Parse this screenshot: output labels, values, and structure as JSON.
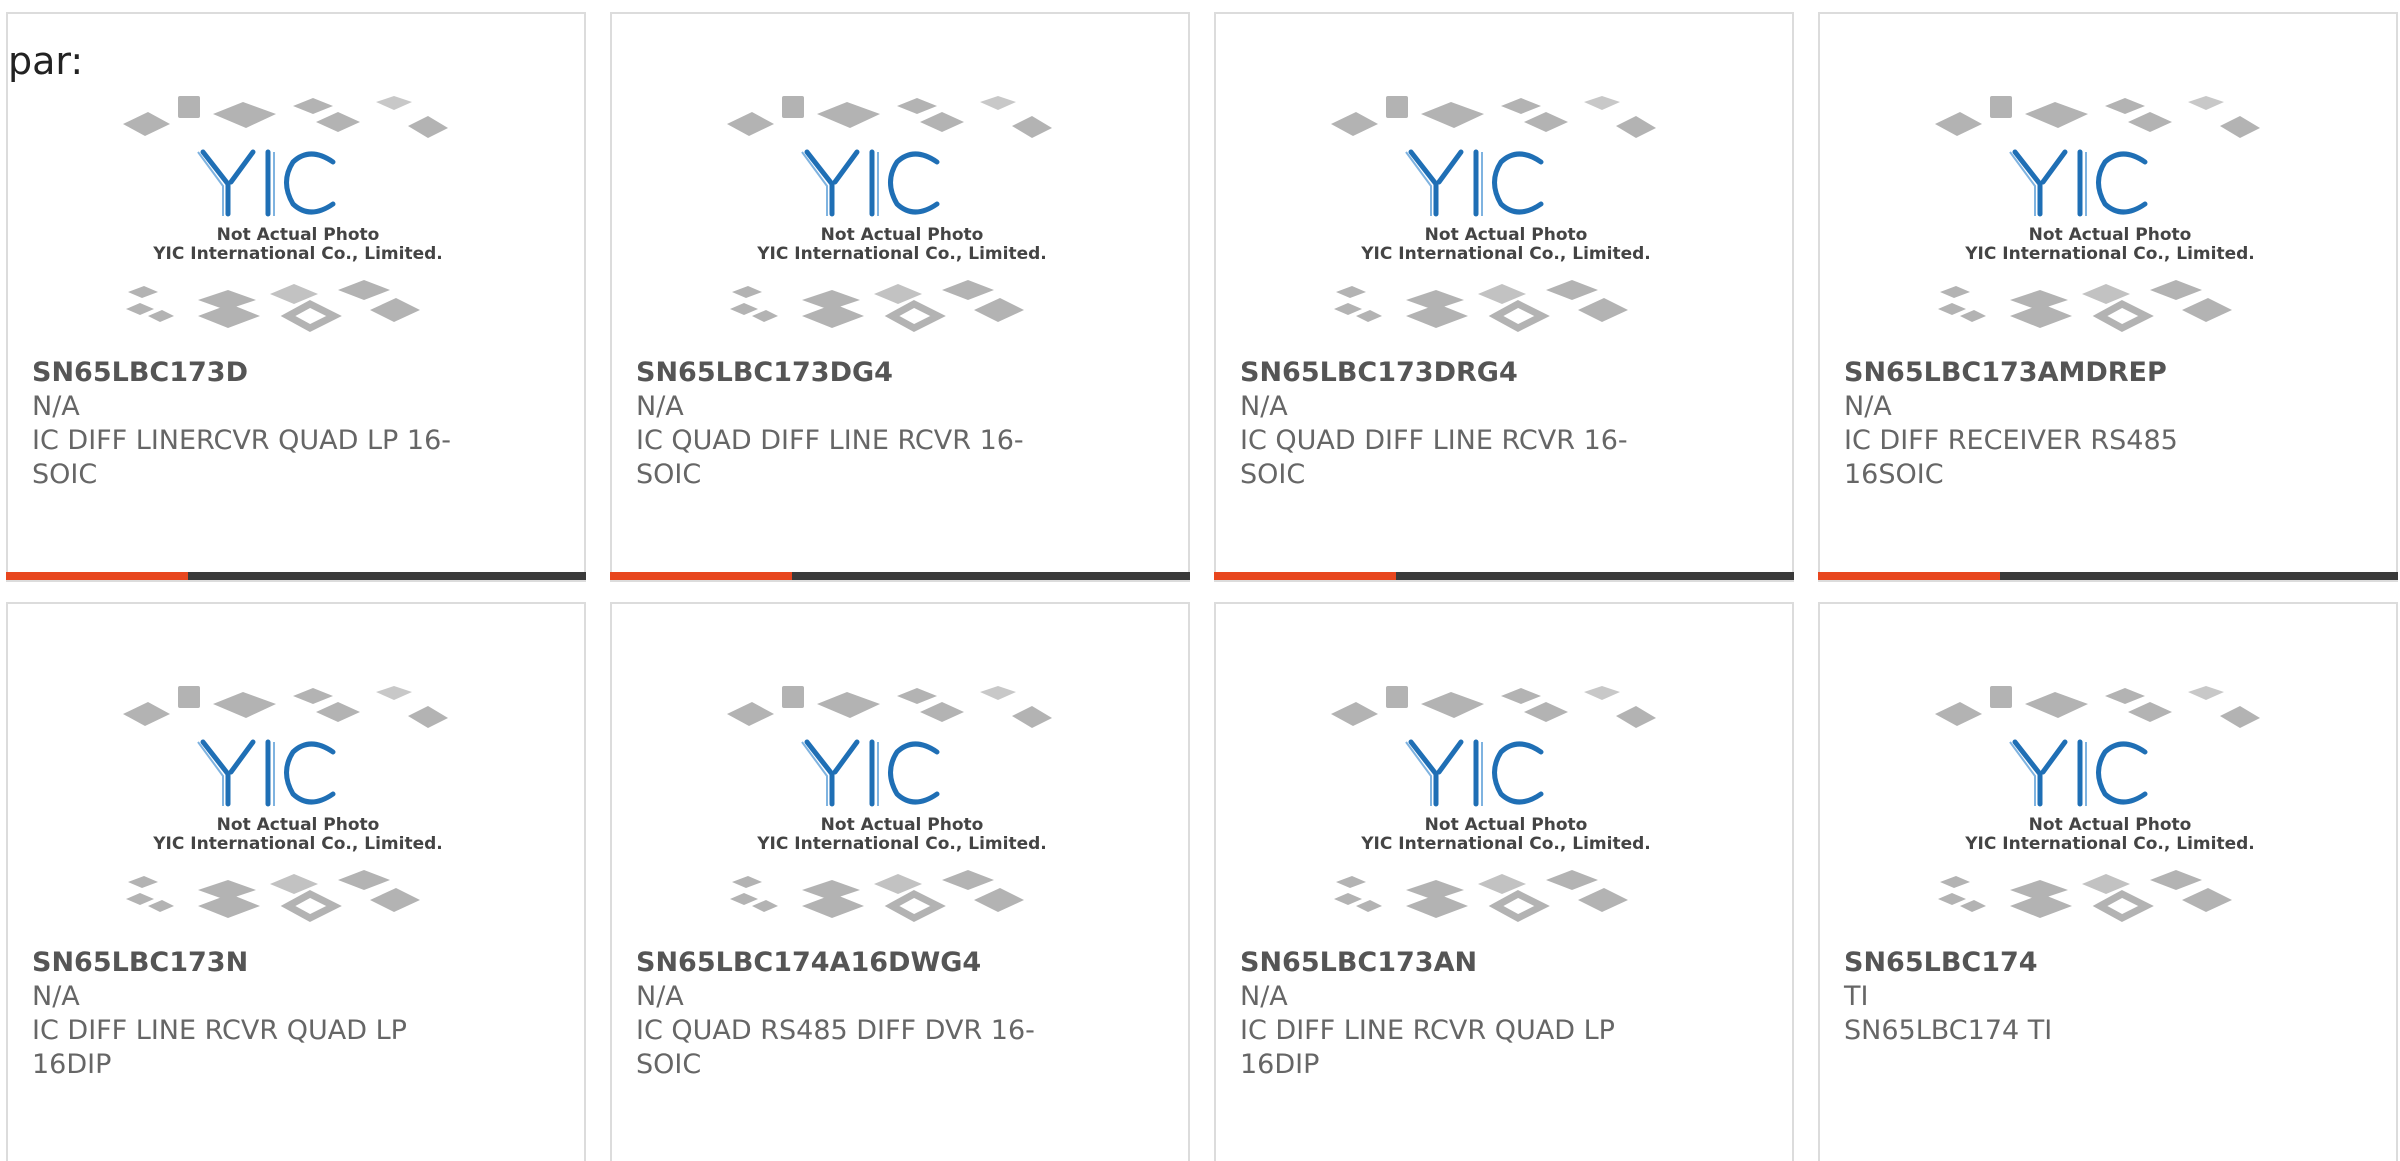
{
  "section_label": "par:",
  "placeholder_image": {
    "line1": "Not Actual Photo",
    "line2": "YIC International Co., Limited."
  },
  "colors": {
    "accent": "#e8461e",
    "bar": "#3a3a3a",
    "logo_blue": "#1f6fb5",
    "chip_gray": "#a8a8a8"
  },
  "products": [
    {
      "part": "SN65LBC173D",
      "manufacturer": "N/A",
      "description": "IC DIFF LINERCVR QUAD LP 16-SOIC"
    },
    {
      "part": "SN65LBC173DG4",
      "manufacturer": "N/A",
      "description": "IC QUAD DIFF LINE RCVR 16-SOIC"
    },
    {
      "part": "SN65LBC173DRG4",
      "manufacturer": "N/A",
      "description": "IC QUAD DIFF LINE RCVR 16-SOIC"
    },
    {
      "part": "SN65LBC173AMDREP",
      "manufacturer": "N/A",
      "description": "IC DIFF RECEIVER RS485 16SOIC"
    },
    {
      "part": "SN65LBC173N",
      "manufacturer": "N/A",
      "description": "IC DIFF LINE RCVR QUAD LP 16DIP"
    },
    {
      "part": "SN65LBC174A16DWG4",
      "manufacturer": "N/A",
      "description": "IC QUAD RS485 DIFF DVR 16-SOIC"
    },
    {
      "part": "SN65LBC173AN",
      "manufacturer": "N/A",
      "description": "IC DIFF LINE RCVR QUAD LP 16DIP"
    },
    {
      "part": "SN65LBC174",
      "manufacturer": "TI",
      "description": "SN65LBC174 TI"
    }
  ]
}
